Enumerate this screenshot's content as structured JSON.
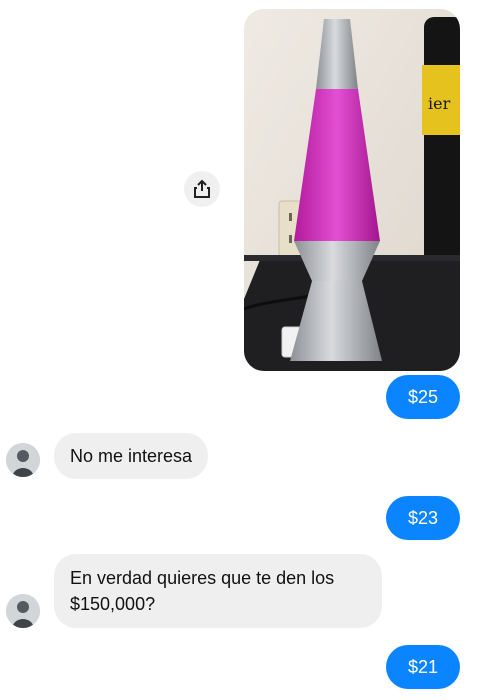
{
  "conversation": {
    "messages": [
      {
        "sender": "me",
        "type": "image",
        "image_description": "lava-lamp-photo"
      },
      {
        "sender": "me",
        "type": "text",
        "text": "$25"
      },
      {
        "sender": "them",
        "type": "text",
        "text": "No me interesa"
      },
      {
        "sender": "me",
        "type": "text",
        "text": "$23"
      },
      {
        "sender": "them",
        "type": "text",
        "text": "En verdad quieres que te den los $150,000?"
      },
      {
        "sender": "me",
        "type": "text",
        "text": "$21"
      }
    ]
  },
  "colors": {
    "outgoing_bubble": "#0b84ff",
    "incoming_bubble": "#efefef",
    "background": "#ffffff"
  },
  "icons": {
    "share": "share-icon",
    "avatar": "avatar"
  }
}
